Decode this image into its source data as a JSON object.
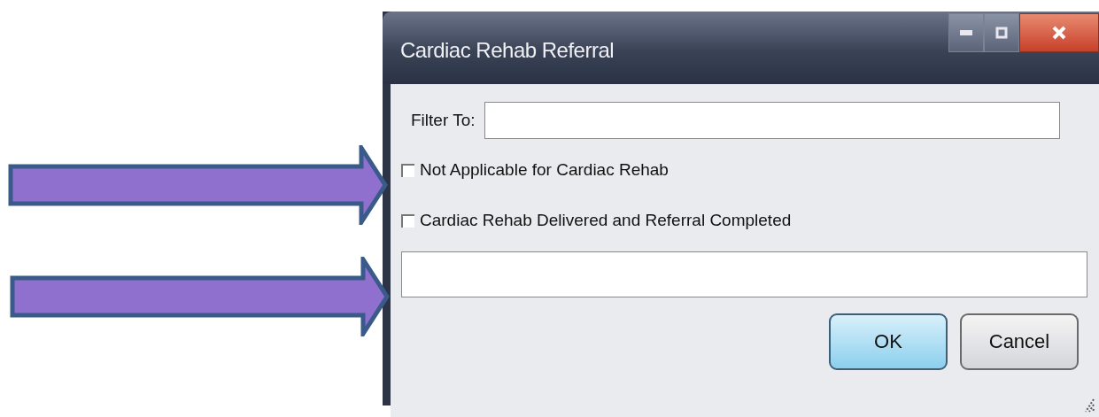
{
  "window": {
    "title": "Cardiac Rehab Referral"
  },
  "filter": {
    "label": "Filter To:"
  },
  "options": [
    {
      "label": "Not Applicable for Cardiac Rehab",
      "checked": false
    },
    {
      "label": "Cardiac Rehab Delivered and Referral Completed",
      "checked": false
    }
  ],
  "buttons": [
    {
      "label": "OK",
      "default": true
    },
    {
      "label": "Cancel",
      "default": false
    }
  ],
  "annotations": [
    {
      "kind": "arrow"
    },
    {
      "kind": "arrow"
    }
  ]
}
